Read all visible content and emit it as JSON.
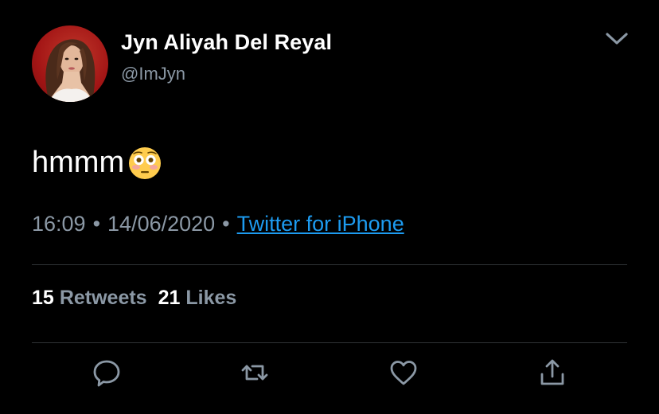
{
  "user": {
    "name": "Jyn Aliyah Del Reyal",
    "handle": "@ImJyn",
    "avatar_icon": "profile-photo"
  },
  "tweet": {
    "text": "hmmm",
    "emoji": "flushed-face",
    "time": "16:09",
    "separator": "•",
    "date": "14/06/2020",
    "source": "Twitter for iPhone"
  },
  "stats": {
    "retweets_count": "15",
    "retweets_label": "Retweets",
    "likes_count": "21",
    "likes_label": "Likes"
  },
  "actions": [
    "reply-icon",
    "retweet-icon",
    "like-icon",
    "share-icon"
  ],
  "colors": {
    "background": "#000000",
    "text": "#ffffff",
    "secondary": "#8b98a5",
    "link": "#1d9bf0",
    "divider": "#2f3336",
    "avatar_bg": "#b01c1c"
  }
}
